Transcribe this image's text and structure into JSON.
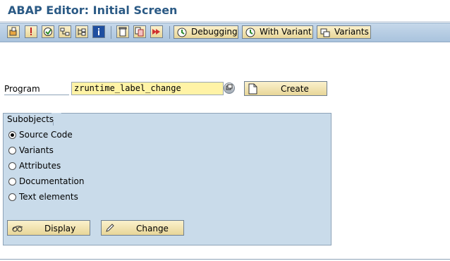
{
  "window": {
    "title": "ABAP Editor: Initial Screen"
  },
  "toolbar": {
    "buttons": [
      {
        "icon": "other-object-icon"
      },
      {
        "icon": "syntax-check-icon"
      },
      {
        "icon": "activate-icon"
      },
      {
        "icon": "where-used-icon"
      },
      {
        "icon": "object-list-icon"
      },
      {
        "icon": "info-icon"
      },
      {
        "icon": "delete-icon"
      },
      {
        "icon": "copy-icon"
      },
      {
        "icon": "rename-icon"
      }
    ],
    "debugging_label": "Debugging",
    "with_variant_label": "With Variant",
    "variants_label": "Variants"
  },
  "program": {
    "label": "Program",
    "value": "zruntime_label_change",
    "create_label": "Create"
  },
  "subobjects": {
    "title": "Subobjects",
    "options": [
      {
        "label": "Source Code",
        "checked": true
      },
      {
        "label": "Variants",
        "checked": false
      },
      {
        "label": "Attributes",
        "checked": false
      },
      {
        "label": "Documentation",
        "checked": false
      },
      {
        "label": "Text elements",
        "checked": false
      }
    ],
    "display_label": "Display",
    "change_label": "Change"
  }
}
